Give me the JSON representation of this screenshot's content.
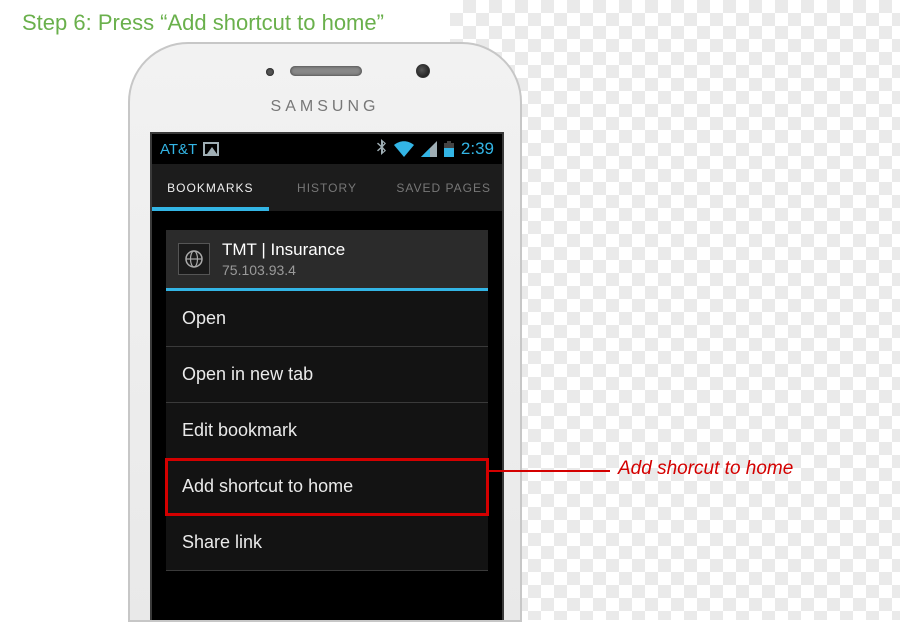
{
  "instruction": {
    "step_label": "Step 6: Press “Add shortcut to home”",
    "callout": "Add shorcut to home"
  },
  "device": {
    "brand": "SAMSUNG"
  },
  "statusbar": {
    "carrier": "AT&T",
    "clock": "2:39"
  },
  "tabs": {
    "bookmarks": "BOOKMARKS",
    "history": "HISTORY",
    "saved": "SAVED PAGES"
  },
  "bookmark": {
    "title": "TMT | Insurance",
    "subtitle": "75.103.93.4"
  },
  "menu": {
    "open": "Open",
    "open_new_tab": "Open in new tab",
    "edit": "Edit bookmark",
    "add_shortcut": "Add shortcut to home",
    "share": "Share link"
  }
}
